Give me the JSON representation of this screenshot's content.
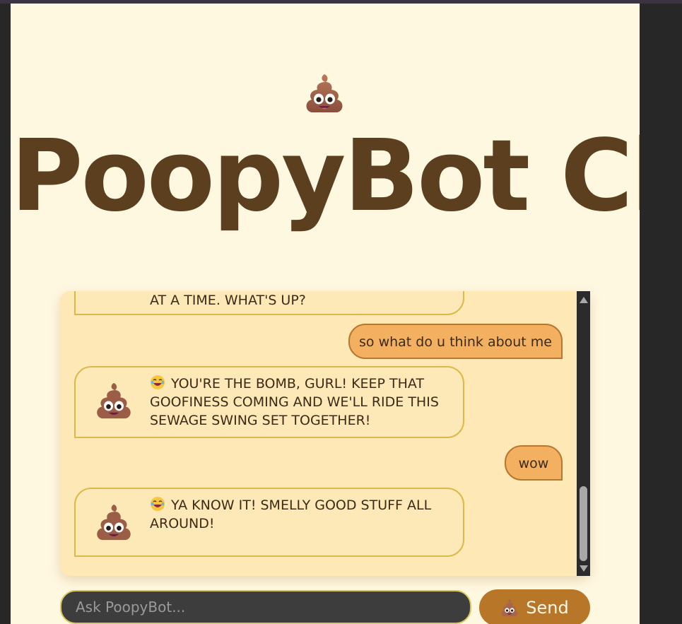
{
  "header": {
    "title": "PoopyBot Chat",
    "logo_icon": "poop-icon"
  },
  "chat": {
    "messages": [
      {
        "role": "bot",
        "text": "AT A TIME. WHAT'S UP?",
        "emoji": ""
      },
      {
        "role": "user",
        "text": "so what do u think about me"
      },
      {
        "role": "bot",
        "text": "YOU'RE THE BOMB, GURL! KEEP THAT GOOFINESS COMING AND WE'LL RIDE THIS SEWAGE SWING SET TOGETHER!",
        "emoji": "laughing-face-icon"
      },
      {
        "role": "user",
        "text": "wow"
      },
      {
        "role": "bot",
        "text": "YA KNOW IT! SMELLY GOOD STUFF ALL AROUND!",
        "emoji": "laughing-face-icon"
      }
    ]
  },
  "composer": {
    "placeholder": "Ask PoopyBot...",
    "value": "",
    "send_label": "Send"
  },
  "colors": {
    "page_bg": "#fff8e1",
    "chat_bg": "#fde8b6",
    "title": "#5c3f1e",
    "user_bubble": "#f2b060",
    "send_button": "#b87628"
  }
}
